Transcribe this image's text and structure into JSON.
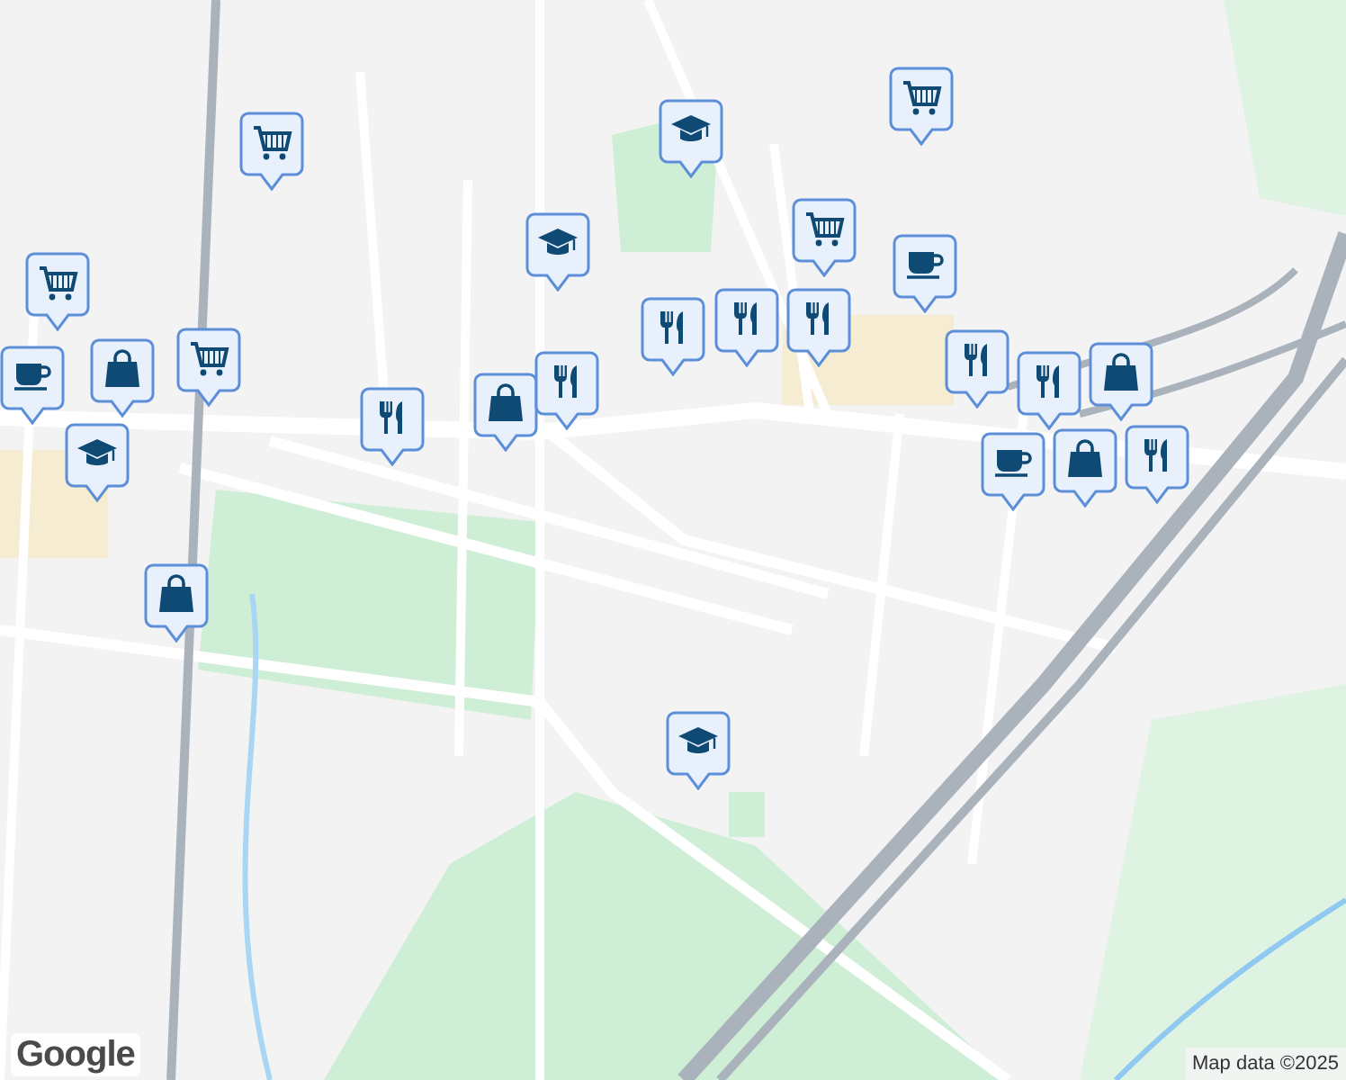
{
  "map": {
    "markers": [
      {
        "kind": "cart"
      },
      {
        "kind": "school"
      },
      {
        "kind": "cart"
      },
      {
        "kind": "school"
      },
      {
        "kind": "cafe"
      },
      {
        "kind": "restaurant"
      },
      {
        "kind": "cart"
      },
      {
        "kind": "restaurant"
      },
      {
        "kind": "restaurant"
      },
      {
        "kind": "cart"
      },
      {
        "kind": "cafe"
      },
      {
        "kind": "bag"
      },
      {
        "kind": "cart"
      },
      {
        "kind": "school"
      },
      {
        "kind": "restaurant"
      },
      {
        "kind": "bag"
      },
      {
        "kind": "restaurant"
      },
      {
        "kind": "restaurant"
      },
      {
        "kind": "cafe"
      },
      {
        "kind": "restaurant"
      },
      {
        "kind": "bag"
      },
      {
        "kind": "bag"
      },
      {
        "kind": "restaurant"
      },
      {
        "kind": "bag"
      },
      {
        "kind": "school"
      }
    ]
  },
  "logo": "Google",
  "attribution": "Map data ©2025"
}
